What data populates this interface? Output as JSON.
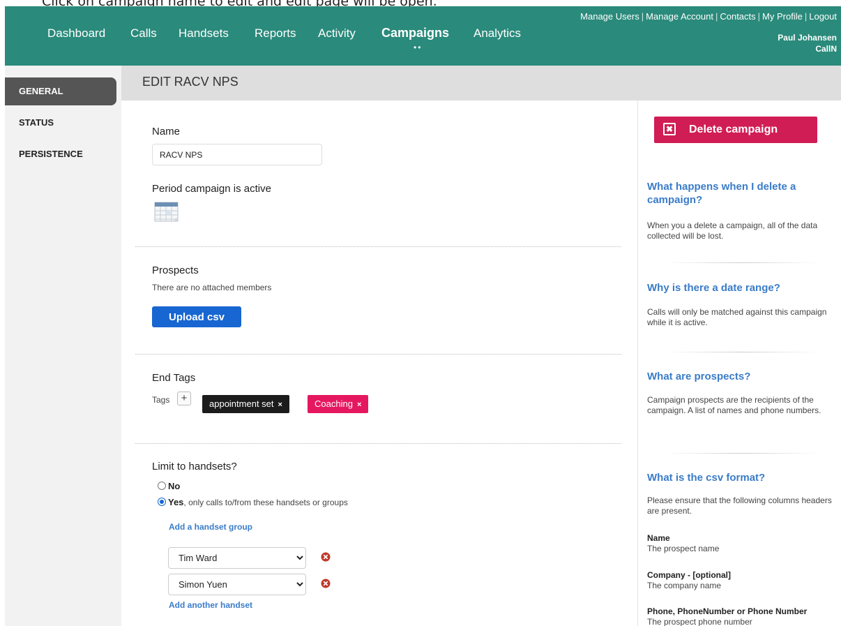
{
  "instruction": "Click on campaign name to edit and edit page will be open.",
  "nav": {
    "items": [
      "Dashboard",
      "Calls",
      "Handsets",
      "Reports",
      "Activity",
      "Campaigns",
      "Analytics"
    ],
    "active": "Campaigns",
    "dots": "••",
    "top_links": [
      "Manage Users",
      "Manage Account",
      "Contacts",
      "My Profile",
      "Logout"
    ],
    "separator": "|",
    "user_name": "Paul Johansen",
    "company": "CallN"
  },
  "sidebar": {
    "items": [
      "GENERAL",
      "STATUS",
      "PERSISTENCE"
    ],
    "active": "GENERAL"
  },
  "page": {
    "title": "EDIT RACV NPS"
  },
  "form": {
    "name_label": "Name",
    "name_value": "RACV NPS",
    "period_label": "Period campaign is active",
    "prospects_label": "Prospects",
    "prospects_note": "There are no attached members",
    "upload_label": "Upload csv",
    "end_tags_label": "End Tags",
    "tags_label": "Tags",
    "tag_add": "+",
    "tags": [
      {
        "label": "appointment set",
        "color": "#1c1c1c"
      },
      {
        "label": "Coaching",
        "color": "#e5185f"
      }
    ],
    "tag_remove": "×",
    "limit_label": "Limit to handsets?",
    "option_no": "No",
    "option_yes": "Yes",
    "option_yes_suffix": ", only calls to/from these handsets or groups",
    "add_group_link": "Add a handset group",
    "handsets": [
      "Tim Ward",
      "Simon Yuen"
    ],
    "add_handset_link": "Add another handset"
  },
  "help": {
    "delete_label": "Delete campaign",
    "delete_icon": "✖",
    "sections": [
      {
        "title": "What happens when I delete a campaign?",
        "body": "When you a delete a campaign, all of the data collected will be lost."
      },
      {
        "title": "Why is there a date range?",
        "body": "Calls will only be matched against this campaign while it is active."
      },
      {
        "title": "What are prospects?",
        "body": "Campaign prospects are the recipients of the campaign. A list of names and phone numbers."
      },
      {
        "title": "What is the csv format?",
        "body": "Please ensure that the following columns headers are present."
      }
    ],
    "columns": [
      {
        "term": "Name",
        "desc": "The prospect name"
      },
      {
        "term": "Company - [optional]",
        "desc": "The company name"
      },
      {
        "term": "Phone, PhoneNumber or Phone Number",
        "desc": "The prospect phone number"
      }
    ]
  },
  "colors": {
    "navbar": "#2a8a7b",
    "primary": "#1766d1",
    "danger": "#d11d55",
    "link": "#3a7cc8"
  }
}
